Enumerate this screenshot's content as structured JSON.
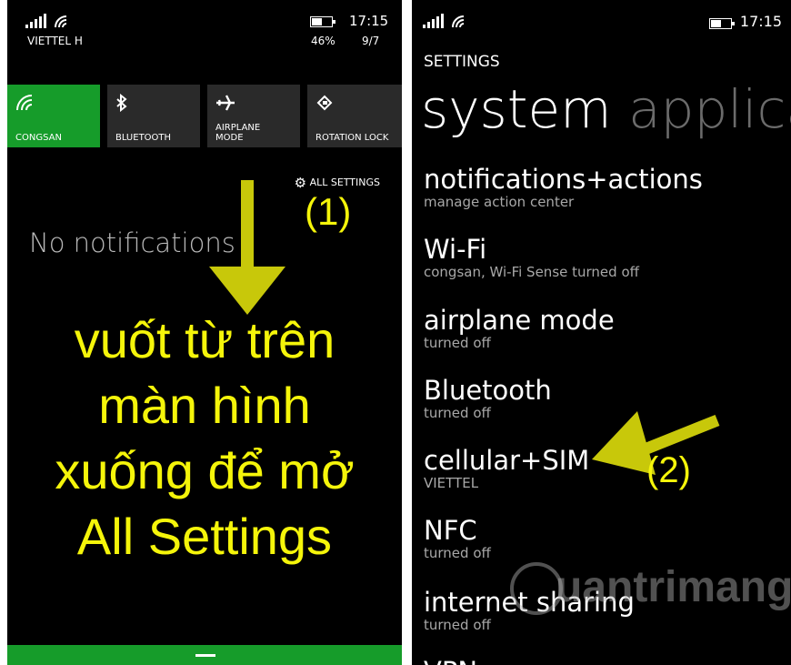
{
  "left": {
    "carrier": "VIETTEL H",
    "time": "17:15",
    "battery": "46%",
    "date": "9/7",
    "tiles": [
      {
        "label": "CONGSAN",
        "icon": "wifi-icon",
        "active": true
      },
      {
        "label": "BLUETOOTH",
        "icon": "bluetooth-icon",
        "active": false
      },
      {
        "label": "AIRPLANE MODE",
        "icon": "airplane-icon",
        "active": false
      },
      {
        "label": "ROTATION LOCK",
        "icon": "rotation-lock-icon",
        "active": false
      }
    ],
    "all_settings": "ALL SETTINGS",
    "no_notifications": "No notifications",
    "step_label": "(1)",
    "caption_lines": [
      "vuốt từ trên",
      "màn hình",
      "xuống để mở",
      "All Settings"
    ],
    "accent_color": "#169c2a",
    "annotation_color": "#f5f50a"
  },
  "right": {
    "time": "17:15",
    "title": "SETTINGS",
    "pivot_active": "system",
    "pivot_next": "applica",
    "items": [
      {
        "name": "notifications+actions",
        "sub": "manage action center"
      },
      {
        "name": "Wi-Fi",
        "sub": "congsan, Wi-Fi Sense turned off"
      },
      {
        "name": "airplane mode",
        "sub": "turned off"
      },
      {
        "name": "Bluetooth",
        "sub": "turned off"
      },
      {
        "name": "cellular+SIM",
        "sub": "VIETTEL"
      },
      {
        "name": "NFC",
        "sub": "turned off"
      },
      {
        "name": "internet sharing",
        "sub": "turned off"
      },
      {
        "name": "VPN",
        "sub": ""
      }
    ],
    "step_label": "(2)",
    "watermark": "uantrimang"
  }
}
